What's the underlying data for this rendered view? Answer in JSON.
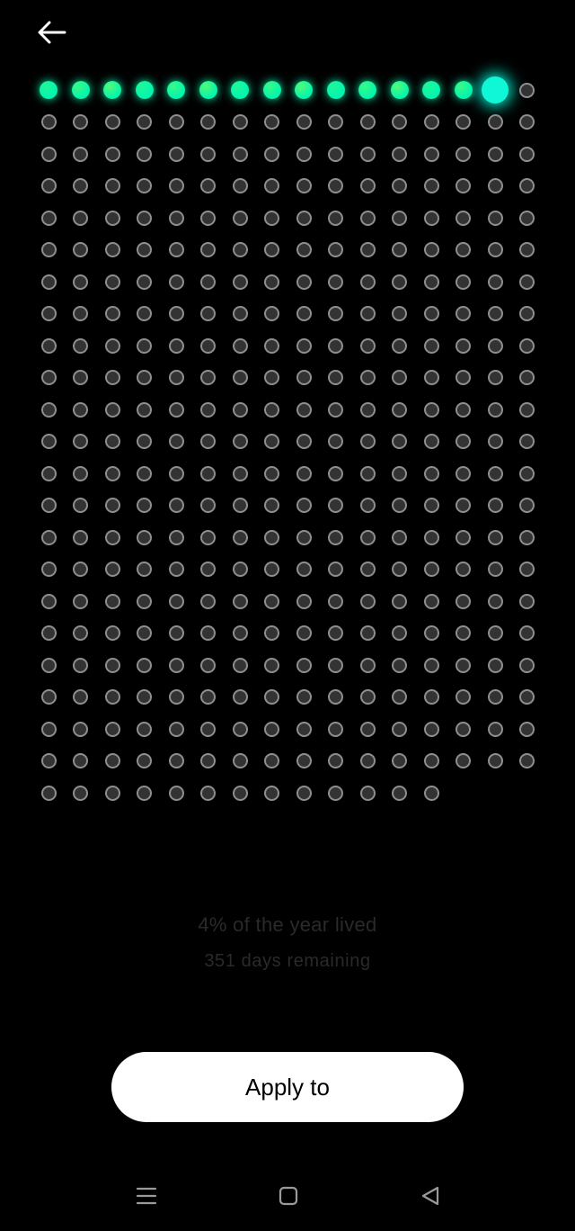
{
  "header": {
    "back_icon": "arrow-left-icon"
  },
  "year_grid": {
    "total_days": 365,
    "days_lived": 14,
    "today_index": 14,
    "columns": 16,
    "colors": {
      "lived_gradient_start": "#00f5b0",
      "lived_gradient_end": "#a6ff3c",
      "today": "#10f7d8",
      "today_glow": "#00e5c8",
      "remaining_fill": "#333333",
      "remaining_border": "#8e8e8e"
    }
  },
  "stats": {
    "percent_lived": "4% of the year lived",
    "days_remaining": "351 days remaining",
    "text_color": "#2a2a2a"
  },
  "actions": {
    "apply_label": "Apply to"
  },
  "system_nav": {
    "items": [
      "menu-icon",
      "home-icon",
      "back-triangle-icon"
    ],
    "color": "#9a9a9a"
  }
}
